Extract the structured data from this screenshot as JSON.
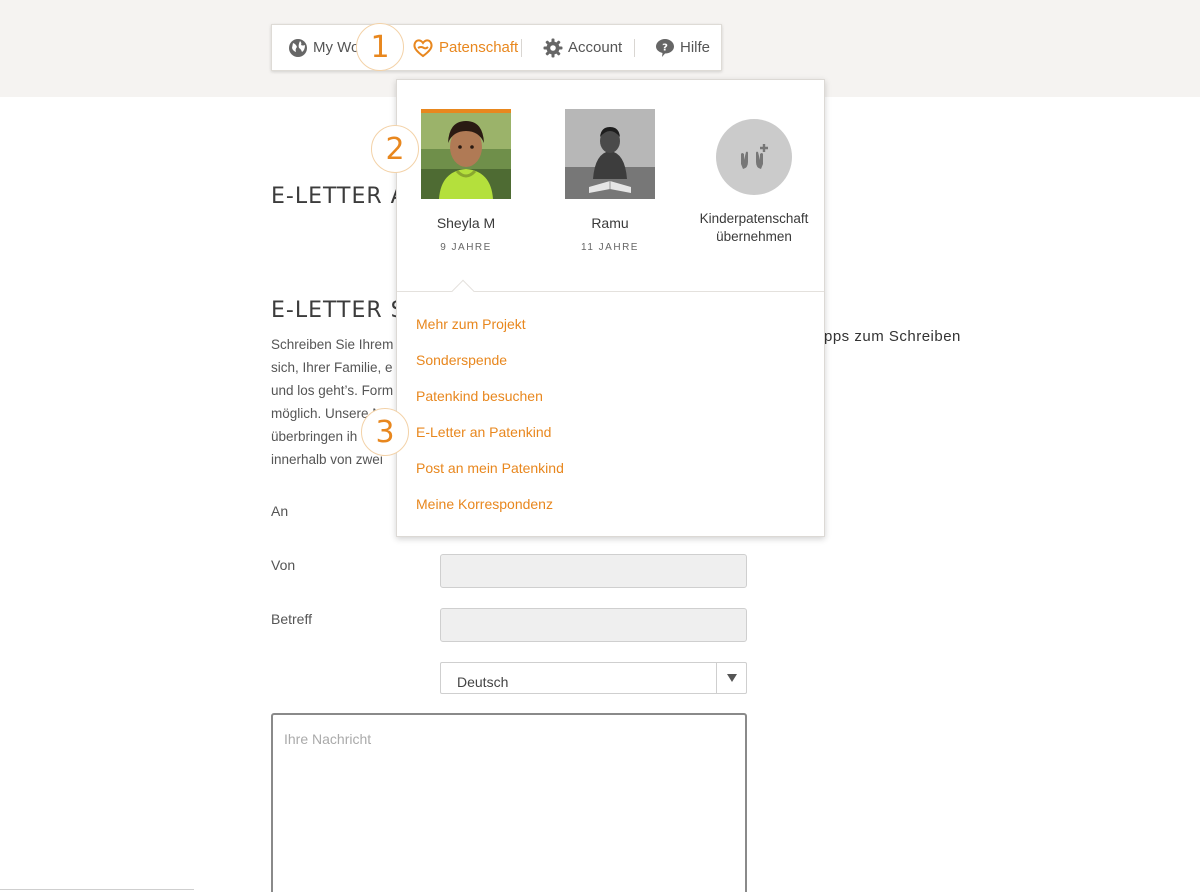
{
  "nav": {
    "items": [
      {
        "label": "My Wo",
        "icon": "globe-icon"
      },
      {
        "label": "Patenschaft",
        "icon": "heart-hand-icon",
        "active": true
      },
      {
        "label": "Account",
        "icon": "gear-icon"
      },
      {
        "label": "Hilfe",
        "icon": "help-bubble-icon"
      }
    ]
  },
  "steps": [
    "1",
    "2",
    "3"
  ],
  "page": {
    "heading_top": "E-LETTER A",
    "heading_main": "E-LETTER S",
    "intro_lines": [
      "Schreiben Sie Ihrem",
      "sich, Ihrer Familie, e",
      "und los geht’s. Form",
      "möglich. Unsere Mi",
      "überbringen ih",
      "innerhalb von zwei"
    ],
    "tips_label": "pps zum Schreiben"
  },
  "form": {
    "to_label": "An",
    "from_label": "Von",
    "subject_label": "Betreff",
    "language_value": "Deutsch",
    "message_placeholder": "Ihre Nachricht"
  },
  "dropdown": {
    "children": [
      {
        "name": "Sheyla M",
        "age": "9 JAHRE",
        "selected": true
      },
      {
        "name": "Ramu",
        "age": "11 JAHRE",
        "selected": false
      }
    ],
    "add_label_line1": "Kinderpatenschaft",
    "add_label_line2": "übernehmen",
    "links": [
      "Mehr zum Projekt",
      "Sonderspende",
      "Patenkind besuchen",
      "E-Letter an Patenkind",
      "Post an mein Patenkind",
      "Meine Korrespondenz"
    ]
  },
  "colors": {
    "accent": "#e8871e",
    "band": "#f5f3f1",
    "input_bg": "#efefef"
  }
}
